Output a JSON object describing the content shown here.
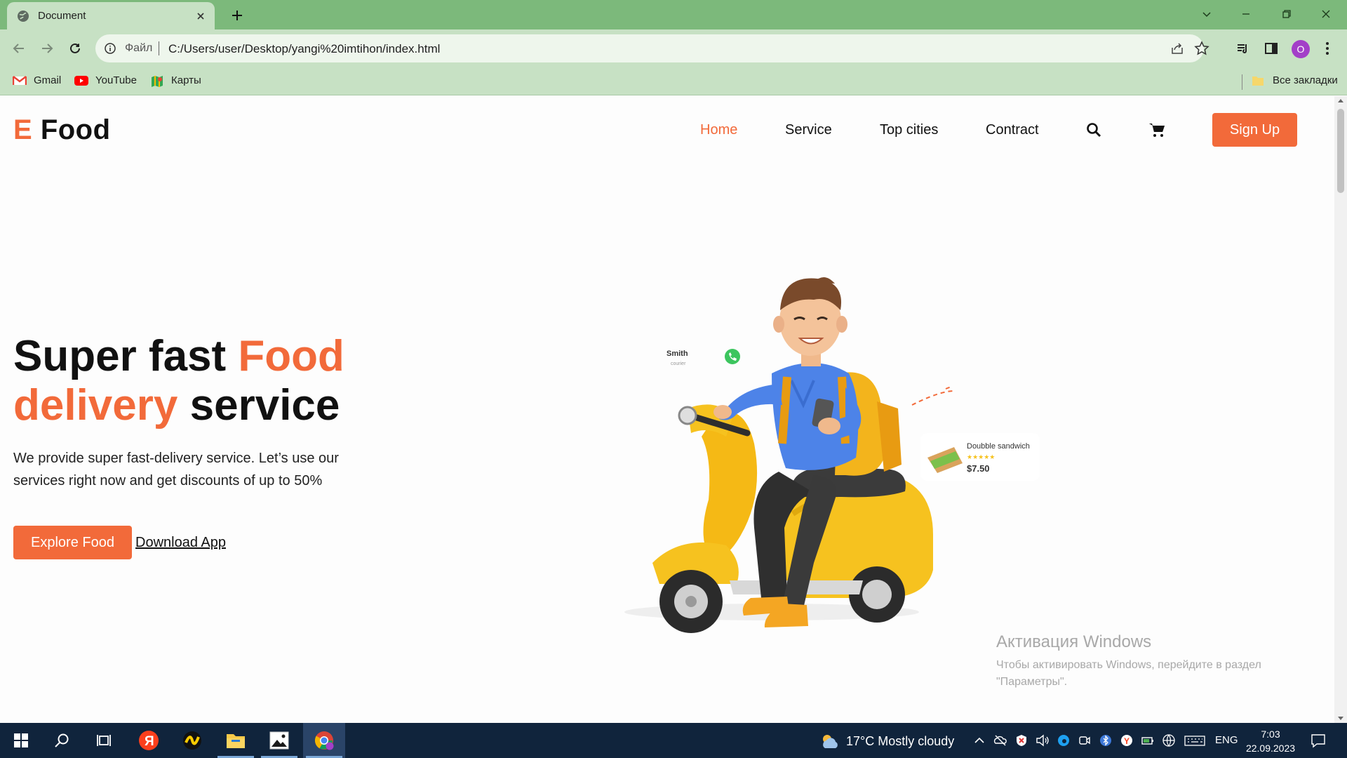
{
  "browser": {
    "tab_title": "Document",
    "address_scheme": "Файл",
    "url": "C:/Users/user/Desktop/yangi%20imtihon/index.html",
    "profile_initial": "O",
    "bookmarks": [
      {
        "label": "Gmail",
        "icon": "gmail-icon"
      },
      {
        "label": "YouTube",
        "icon": "youtube-icon"
      },
      {
        "label": "Карты",
        "icon": "maps-icon"
      }
    ],
    "all_bookmarks_label": "Все закладки"
  },
  "site": {
    "logo_letter": "E",
    "logo_word": "Food",
    "nav": [
      "Home",
      "Service",
      "Top cities",
      "Contract"
    ],
    "signup_label": "Sign Up",
    "hero": {
      "title_part1": "Super fast ",
      "title_accent1": "Food",
      "title_accent2": "delivery",
      "title_part2": " service",
      "description": "We provide super fast-delivery service. Let’s use our services right now and get discounts of up to 50%",
      "explore_label": "Explore Food",
      "download_label": "Download App"
    },
    "illustration": {
      "caller_name": "Smith",
      "caller_role": "courier",
      "product_name": "Doubble sandwich",
      "product_price": "$7.50",
      "rating_stars": 5
    }
  },
  "watermark": {
    "title": "Активация Windows",
    "text": "Чтобы активировать Windows, перейдите в раздел \"Параметры\"."
  },
  "taskbar": {
    "weather": "17°C  Mostly cloudy",
    "language": "ENG",
    "time": "7:03",
    "date": "22.09.2023"
  },
  "colors": {
    "accent": "#f26a3a",
    "browser_frame": "#7cb97b",
    "browser_toolbar": "#c7e1c4",
    "taskbar": "#10243c"
  }
}
